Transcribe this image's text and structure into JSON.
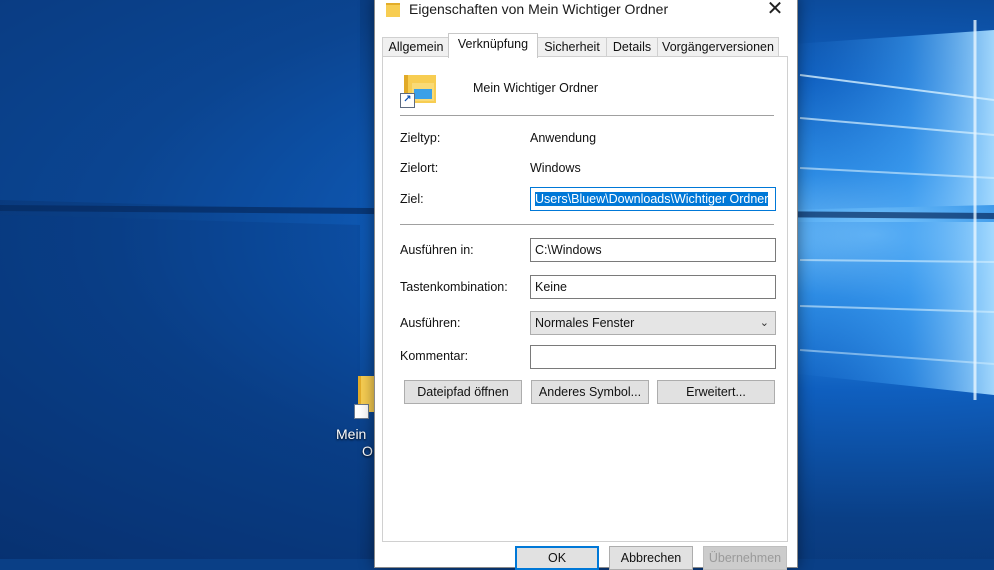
{
  "desktop": {
    "shortcut_label_line1": "Mein",
    "shortcut_label_line2": "O"
  },
  "dialog": {
    "title": "Eigenschaften von Mein Wichtiger Ordner",
    "close_glyph": "✕",
    "tabs": [
      {
        "label": "Allgemein",
        "active": false
      },
      {
        "label": "Verknüpfung",
        "active": true
      },
      {
        "label": "Sicherheit",
        "active": false
      },
      {
        "label": "Details",
        "active": false
      },
      {
        "label": "Vorgängerversionen",
        "active": false
      }
    ],
    "item_name": "Mein Wichtiger Ordner",
    "zieltyp_label": "Zieltyp:",
    "zieltyp_value": "Anwendung",
    "zielort_label": "Zielort:",
    "zielort_value": "Windows",
    "ziel_label": "Ziel:",
    "ziel_value": "Users\\Bluew\\Downloads\\Wichtiger Ordner",
    "ausfuehren_in_label": "Ausführen in:",
    "ausfuehren_in_value": "C:\\Windows",
    "tastenkombination_label": "Tastenkombination:",
    "tastenkombination_value": "Keine",
    "ausfuehren_label": "Ausführen:",
    "ausfuehren_value": "Normales Fenster",
    "kommentar_label": "Kommentar:",
    "kommentar_value": "",
    "buttons": {
      "dateipfad": "Dateipfad öffnen",
      "symbol": "Anderes Symbol...",
      "erweitert": "Erweitert..."
    },
    "bottom_buttons": {
      "ok": "OK",
      "cancel": "Abbrechen",
      "apply": "Übernehmen"
    }
  },
  "colors": {
    "accent": "#0078d7",
    "desktop_dark": "#0a3f86",
    "folder": "#f7cd52"
  }
}
